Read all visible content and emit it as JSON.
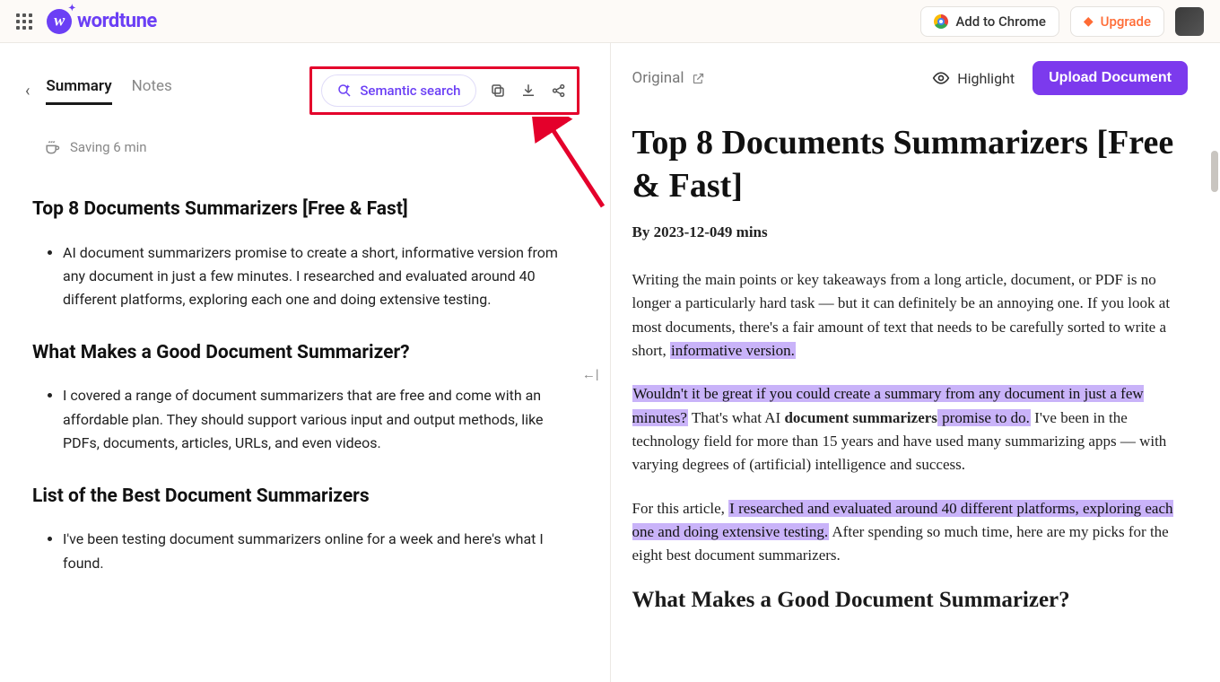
{
  "brand": {
    "name": "wordtune"
  },
  "topbar": {
    "add_to_chrome": "Add to Chrome",
    "upgrade": "Upgrade"
  },
  "left": {
    "tabs": {
      "summary": "Summary",
      "notes": "Notes"
    },
    "semantic_search": "Semantic search",
    "saving": "Saving 6 min",
    "h1": "Top 8 Documents Summarizers [Free & Fast]",
    "b1": "AI document summarizers promise to create a short, informative version from any document in just a few minutes. I researched and evaluated around 40 different platforms, exploring each one and doing extensive testing.",
    "h2": "What Makes a Good Document Summarizer?",
    "b2": "I covered a range of document summarizers that are free and come with an affordable plan. They should support various input and output methods, like PDFs, documents, articles, URLs, and even videos.",
    "h3": "List of the Best Document Summarizers",
    "b3": "I've been testing document summarizers online for a week and here's what I found."
  },
  "right": {
    "original": "Original",
    "highlight": "Highlight",
    "upload": "Upload Document",
    "title": "Top 8 Documents Summarizers [Free & Fast]",
    "byline": "By 2023-12-049 mins",
    "p1a": "Writing the main points or key takeaways from a long article, document, or PDF is no longer a particularly hard task — but it can definitely be an annoying one. If you look at most documents, there's a fair amount of text that needs to be carefully sorted to write a short, ",
    "p1m": "informative version.",
    "p2m1": "Wouldn't it be great if you could create a summary from any document in just a few minutes?",
    "p2a": " That's what AI ",
    "p2b": "document summarizers",
    "p2m2": " promise to do.",
    "p2c": " I've been in the technology field for more than 15 years and have used many summarizing apps — with varying degrees of (artificial) intelligence and success.",
    "p3a": "For this article, ",
    "p3m": "I researched and evaluated around 40 different platforms, exploring each one and doing extensive testing.",
    "p3b": " After spending so much time, here are my picks for the eight best document summarizers.",
    "sec2": "What Makes a Good Document Summarizer?"
  }
}
